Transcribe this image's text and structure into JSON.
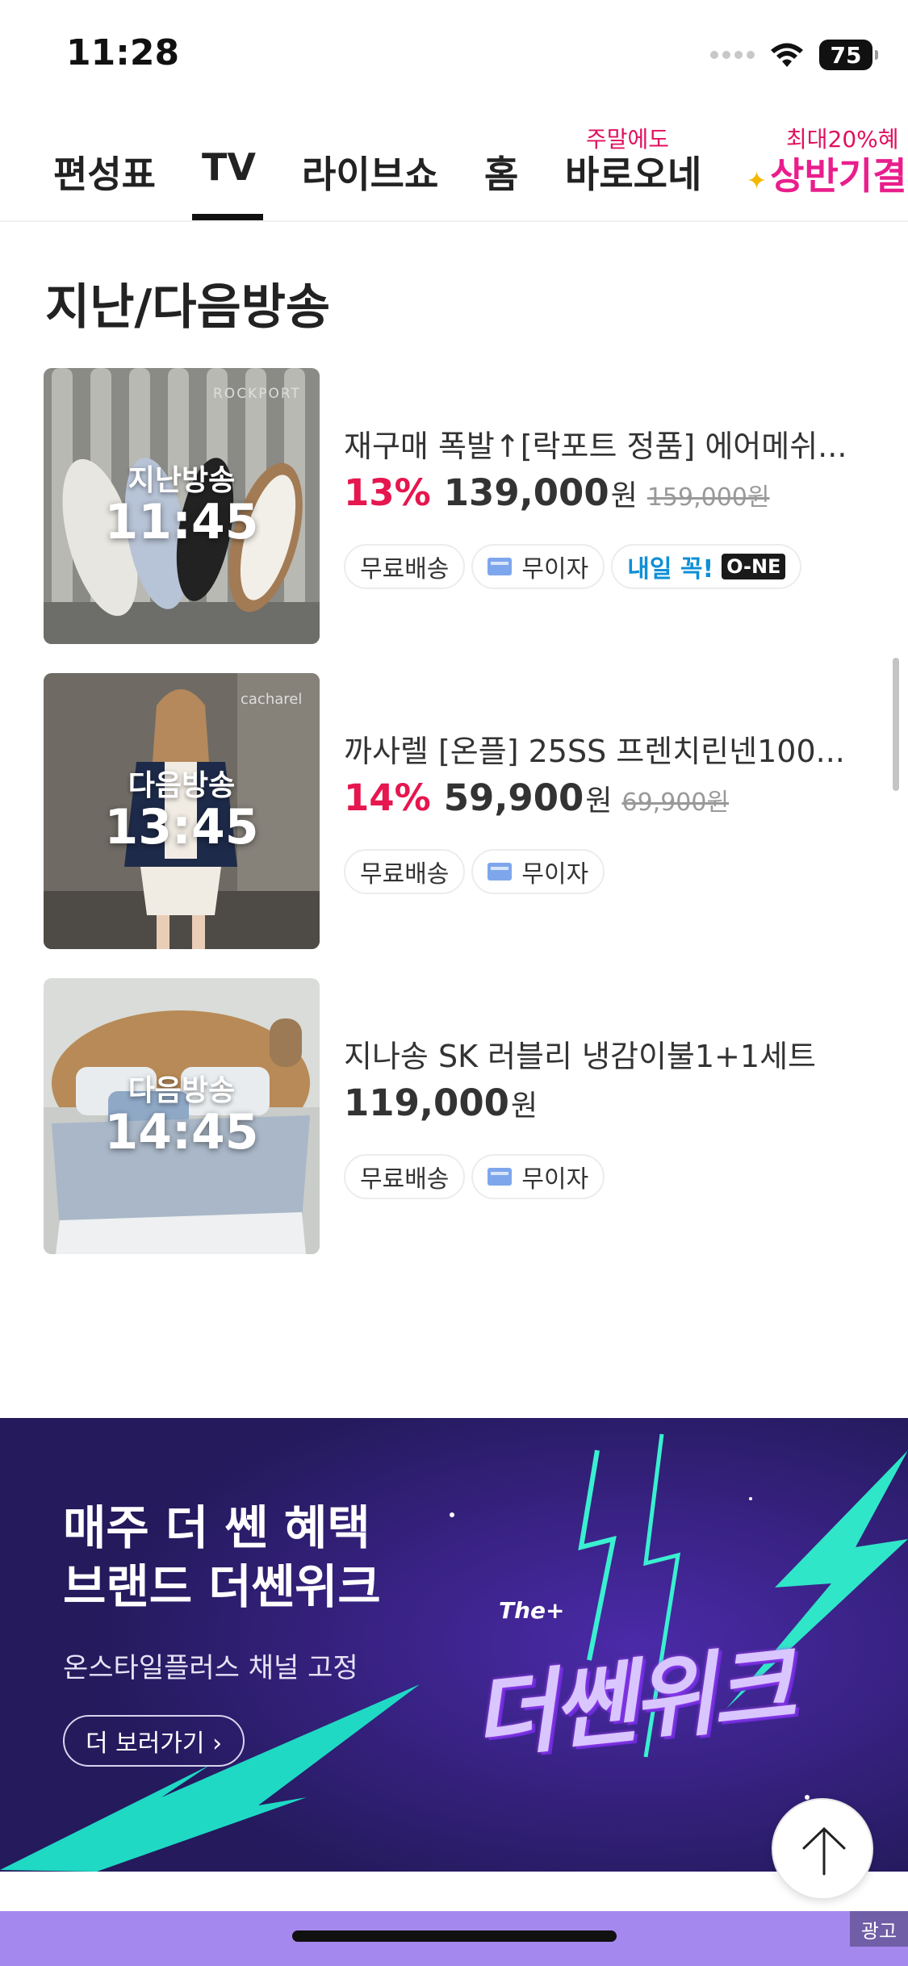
{
  "status_bar": {
    "time": "11:28",
    "battery": "75"
  },
  "tabs": [
    {
      "label": "편성표",
      "badge": ""
    },
    {
      "label": "TV",
      "badge": "",
      "active": true
    },
    {
      "label": "라이브쇼",
      "badge": ""
    },
    {
      "label": "홈",
      "badge": ""
    },
    {
      "label": "바로오네",
      "badge": "주말에도"
    },
    {
      "label": "상반기결",
      "badge": "최대20%혜"
    }
  ],
  "section": {
    "title": "지난/다음방송"
  },
  "products": [
    {
      "status": "지난방송",
      "time": "11:45",
      "brand": "ROCKPORT",
      "title": "재구매 폭발↑[락포트 정품] 에어메쉬...",
      "discount": "13%",
      "price": "139,000",
      "unit": "원",
      "original_price": "159,000원",
      "tags": [
        "무료배송",
        "무이자",
        "내일 꼭!"
      ],
      "one_logo": "O-NE"
    },
    {
      "status": "다음방송",
      "time": "13:45",
      "brand": "cacharel",
      "title": "까사렐 [온플] 25SS 프렌치린넨100...",
      "discount": "14%",
      "price": "59,900",
      "unit": "원",
      "original_price": "69,900원",
      "tags": [
        "무료배송",
        "무이자"
      ]
    },
    {
      "status": "다음방송",
      "time": "14:45",
      "title": "지나송 SK 러블리 냉감이불1+1세트",
      "price": "119,000",
      "unit": "원",
      "tags": [
        "무료배송",
        "무이자"
      ]
    }
  ],
  "banner": {
    "headline_1": "매주 더 쎈 혜택",
    "headline_2": "브랜드 더쎈위크",
    "subtitle": "온스타일플러스 채널 고정",
    "button": "더 보러가기 ›",
    "logo_small": "The+",
    "logo": "더쎈위크",
    "ad_label": "광고"
  },
  "colors": {
    "accent_pink": "#e6164f",
    "event_pink": "#e91e8c",
    "banner_bg": "#241a5c",
    "strip_purple": "#a588ee"
  },
  "icons": [
    "wifi-icon",
    "battery-icon",
    "card-icon",
    "arrow-up-icon",
    "sparkle-icon"
  ]
}
